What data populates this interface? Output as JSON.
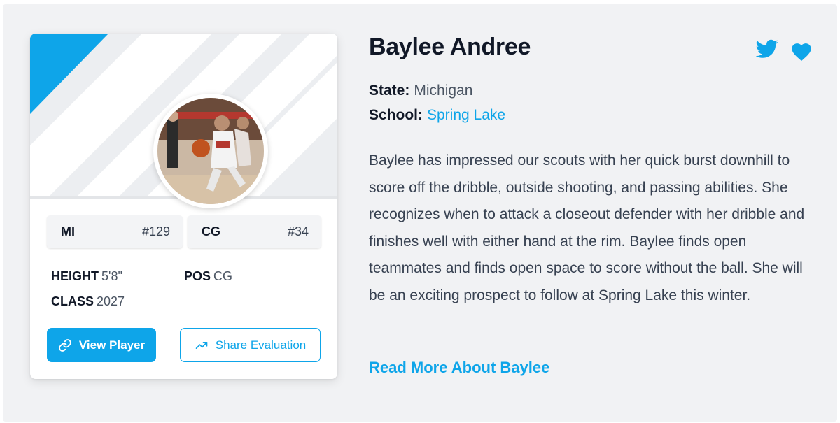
{
  "player": {
    "name": "Baylee Andree",
    "state_label": "State:",
    "state": "Michigan",
    "school_label": "School:",
    "school": "Spring Lake"
  },
  "rankings": [
    {
      "label": "MI",
      "rank": "#129"
    },
    {
      "label": "CG",
      "rank": "#34"
    }
  ],
  "attributes": {
    "height_label": "HEIGHT",
    "height": "5'8\"",
    "pos_label": "POS",
    "pos": "CG",
    "class_label": "CLASS",
    "class": "2027"
  },
  "actions": {
    "view_player": "View Player",
    "share_evaluation": "Share Evaluation",
    "read_more": "Read More About Baylee"
  },
  "bio": "Baylee has impressed our scouts with her quick burst downhill to score off the dribble, outside shooting, and passing abilities. She recognizes when to attack a closeout defender with her dribble and finishes well with either hand at the rim. Baylee finds open teammates and finds open space to score without the ball. She will be an exciting prospect to follow at Spring Lake this winter.",
  "icons": {
    "twitter": "twitter-icon",
    "favorite": "heart-icon",
    "link": "link-icon",
    "trend": "trending-up-icon"
  },
  "colors": {
    "accent": "#0ea5e9",
    "background": "#f1f2f4",
    "card": "#ffffff",
    "heading": "#111827"
  }
}
